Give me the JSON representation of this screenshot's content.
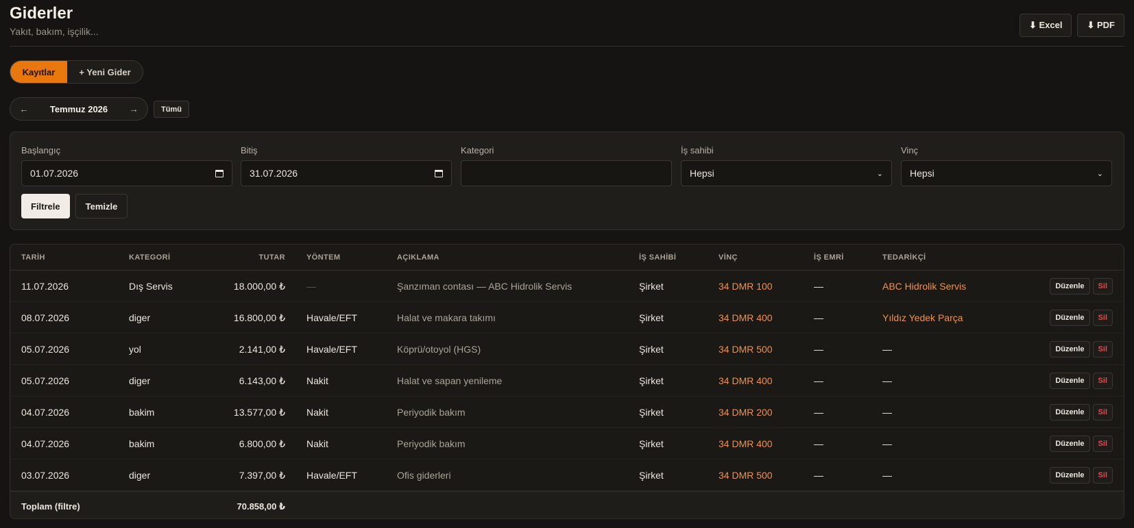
{
  "header": {
    "title": "Giderler",
    "subtitle": "Yakıt, bakım, işçilik...",
    "excel_label": "⬇ Excel",
    "pdf_label": "⬇ PDF"
  },
  "tabs": [
    {
      "label": "Kayıtlar",
      "active": true
    },
    {
      "label": "+ Yeni Gider",
      "active": false
    }
  ],
  "month_nav": {
    "prev": "←",
    "month": "Temmuz 2026",
    "next": "→",
    "all_label": "Tümü"
  },
  "filters": {
    "start": {
      "label": "Başlangıç",
      "value": "01.07.2026"
    },
    "end": {
      "label": "Bitiş",
      "value": "31.07.2026"
    },
    "category": {
      "label": "Kategori",
      "value": ""
    },
    "owner": {
      "label": "İş sahibi",
      "value": "Hepsi"
    },
    "crane": {
      "label": "Vinç",
      "value": "Hepsi"
    },
    "apply_label": "Filtrele",
    "clear_label": "Temizle"
  },
  "table": {
    "headers": {
      "date": "TARİH",
      "category": "KATEGORİ",
      "amount": "TUTAR",
      "method": "YÖNTEM",
      "description": "AÇIKLAMA",
      "owner": "İŞ SAHİBİ",
      "crane": "VİNÇ",
      "work_order": "İŞ EMRİ",
      "supplier": "TEDARİKÇİ"
    },
    "edit_label": "Düzenle",
    "delete_label": "Sil",
    "rows": [
      {
        "date": "11.07.2026",
        "category": "Dış Servis",
        "amount": "18.000,00 ₺",
        "method": "—",
        "description": "Şanzıman contası — ABC Hidrolik Servis",
        "owner": "Şirket",
        "crane": "34 DMR 100",
        "work_order": "—",
        "supplier": "ABC Hidrolik Servis"
      },
      {
        "date": "08.07.2026",
        "category": "diger",
        "amount": "16.800,00 ₺",
        "method": "Havale/EFT",
        "description": "Halat ve makara takımı",
        "owner": "Şirket",
        "crane": "34 DMR 400",
        "work_order": "—",
        "supplier": "Yıldız Yedek Parça"
      },
      {
        "date": "05.07.2026",
        "category": "yol",
        "amount": "2.141,00 ₺",
        "method": "Havale/EFT",
        "description": "Köprü/otoyol (HGS)",
        "owner": "Şirket",
        "crane": "34 DMR 500",
        "work_order": "—",
        "supplier": "—"
      },
      {
        "date": "05.07.2026",
        "category": "diger",
        "amount": "6.143,00 ₺",
        "method": "Nakit",
        "description": "Halat ve sapan yenileme",
        "owner": "Şirket",
        "crane": "34 DMR 400",
        "work_order": "—",
        "supplier": "—"
      },
      {
        "date": "04.07.2026",
        "category": "bakim",
        "amount": "13.577,00 ₺",
        "method": "Nakit",
        "description": "Periyodik bakım",
        "owner": "Şirket",
        "crane": "34 DMR 200",
        "work_order": "—",
        "supplier": "—"
      },
      {
        "date": "04.07.2026",
        "category": "bakim",
        "amount": "6.800,00 ₺",
        "method": "Nakit",
        "description": "Periyodik bakım",
        "owner": "Şirket",
        "crane": "34 DMR 400",
        "work_order": "—",
        "supplier": "—"
      },
      {
        "date": "03.07.2026",
        "category": "diger",
        "amount": "7.397,00 ₺",
        "method": "Havale/EFT",
        "description": "Ofis giderleri",
        "owner": "Şirket",
        "crane": "34 DMR 500",
        "work_order": "—",
        "supplier": "—"
      }
    ],
    "footer": {
      "label": "Toplam (filtre)",
      "total": "70.858,00 ₺"
    }
  }
}
